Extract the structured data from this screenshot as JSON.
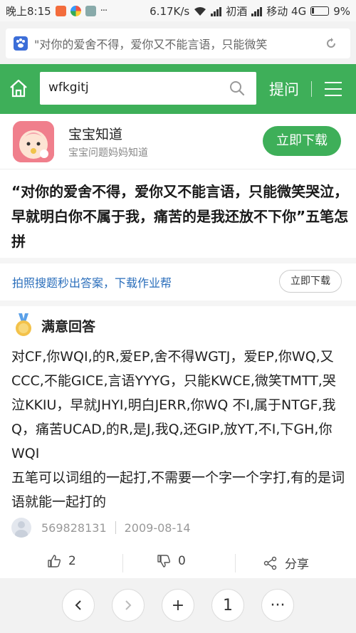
{
  "status_bar": {
    "time": "晚上8:15",
    "dots": "···",
    "speed": "6.17K/s",
    "carrier1": "初酒",
    "carrier2": "移动 4G",
    "battery": "9%"
  },
  "browser": {
    "url_text": "\"对你的爱舍不得，爱你又不能言语，只能微笑"
  },
  "header": {
    "search_value": "wfkgitj",
    "ask_label": "提问",
    "colors": {
      "brand": "#3eaf59"
    }
  },
  "app_banner": {
    "name": "宝宝知道",
    "subtitle": "宝宝问题妈妈知道",
    "download_label": "立即下载"
  },
  "question": {
    "title": "“对你的爱舍不得，爱你又不能言语，只能微笑哭泣，早就明白你不属于我，痛苦的是我还放不下你”五笔怎拼"
  },
  "promo": {
    "text": "拍照搜题秒出答案，下载作业帮",
    "button_label": "立即下载"
  },
  "answer": {
    "badge_label": "满意回答",
    "paragraph1": "对CF,你WQI,的R,爱EP,舍不得WGTJ，爱EP,你WQ,又CCC,不能GICE,言语YYYG，只能KWCE,微笑TMTT,哭泣KKIU，早就JHYI,明白JERR,你WQ 不I,属于NTGF,我Q，痛苦UCAD,的R,是J,我Q,还GIP,放YT,不I,下GH,你WQI",
    "paragraph2": "五笔可以词组的一起打,不需要一个字一个字打,有的是词语就能一起打的",
    "user": "569828131",
    "date": "2009-08-14"
  },
  "actions": {
    "like_count": "2",
    "dislike_count": "0",
    "share_label": "分享"
  },
  "bottom_nav": {
    "page_number": "1",
    "add_glyph": "+",
    "more_glyph": "···"
  }
}
